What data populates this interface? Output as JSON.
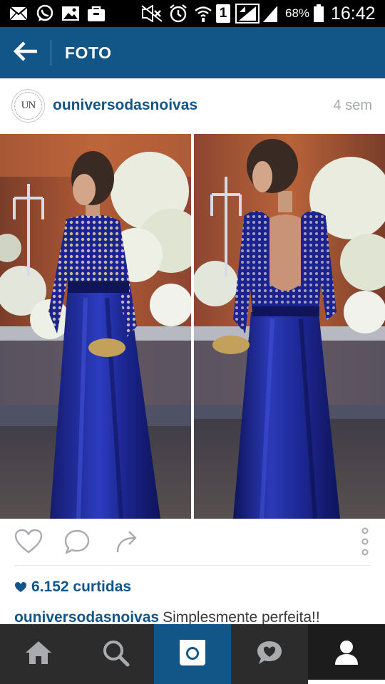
{
  "status_bar": {
    "battery_percent": "68%",
    "time": "16:42",
    "sim_label": "1",
    "icons": [
      "mail-icon",
      "whatsapp-icon",
      "image-icon",
      "bag-icon",
      "mute-icon",
      "alarm-icon",
      "wifi-icon",
      "sim-icon",
      "signal-icon",
      "signal-icon",
      "battery-icon"
    ]
  },
  "app_bar": {
    "title": "FOTO",
    "back_icon": "arrow-left-icon",
    "color": "#125688"
  },
  "post": {
    "username": "ouniversodasnoivas",
    "avatar_mark": "UN",
    "time": "4 sem",
    "likes": "6.152 curtidas",
    "caption_user": "ouniversodasnoivas",
    "caption_text": "Simplesmente perfeita!!"
  },
  "actions": {
    "icons": [
      "heart-icon",
      "comment-icon",
      "share-icon",
      "more-vertical-icon"
    ]
  },
  "bottom_nav": {
    "items": [
      "home-icon",
      "search-icon",
      "camera-icon",
      "activity-icon",
      "profile-icon"
    ],
    "selected": "profile-icon"
  },
  "colors": {
    "brand_blue": "#125688",
    "dress_blue": "#1e2a9a",
    "nav_bg": "#2c2c2c",
    "muted_text": "#a5a7aa"
  }
}
